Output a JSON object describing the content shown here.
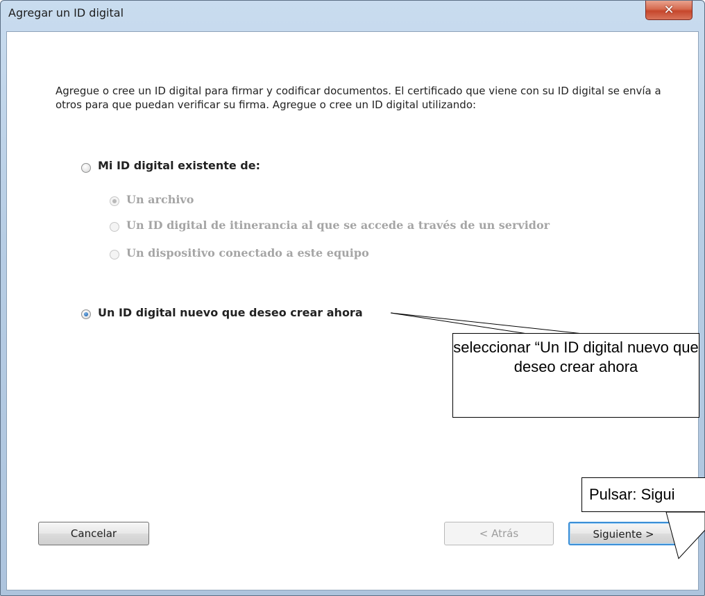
{
  "window": {
    "title": "Agregar un ID digital",
    "close_icon": "close-icon"
  },
  "intro_text": "Agregue o cree un ID digital para firmar y codificar documentos. El certificado que viene con su ID digital se envía a otros para que puedan verificar su firma. Agregue o cree un ID digital utilizando:",
  "options": {
    "existing": {
      "label": "Mi ID digital existente de:",
      "checked": false
    },
    "sub_options": [
      {
        "label": "Un archivo",
        "checked": true,
        "disabled": true
      },
      {
        "label": "Un ID digital de itinerancia al que se accede a través de un servidor",
        "checked": false,
        "disabled": true
      },
      {
        "label": "Un dispositivo conectado a este equipo",
        "checked": false,
        "disabled": true
      }
    ],
    "new": {
      "label": "Un ID digital nuevo que deseo crear ahora",
      "checked": true
    }
  },
  "buttons": {
    "cancel": "Cancelar",
    "back": "< Atrás",
    "next": "Siguiente >"
  },
  "annotations": {
    "callout_select": "seleccionar “Un ID digital nuevo que deseo crear ahora",
    "callout_next": "Pulsar: Sigui"
  }
}
